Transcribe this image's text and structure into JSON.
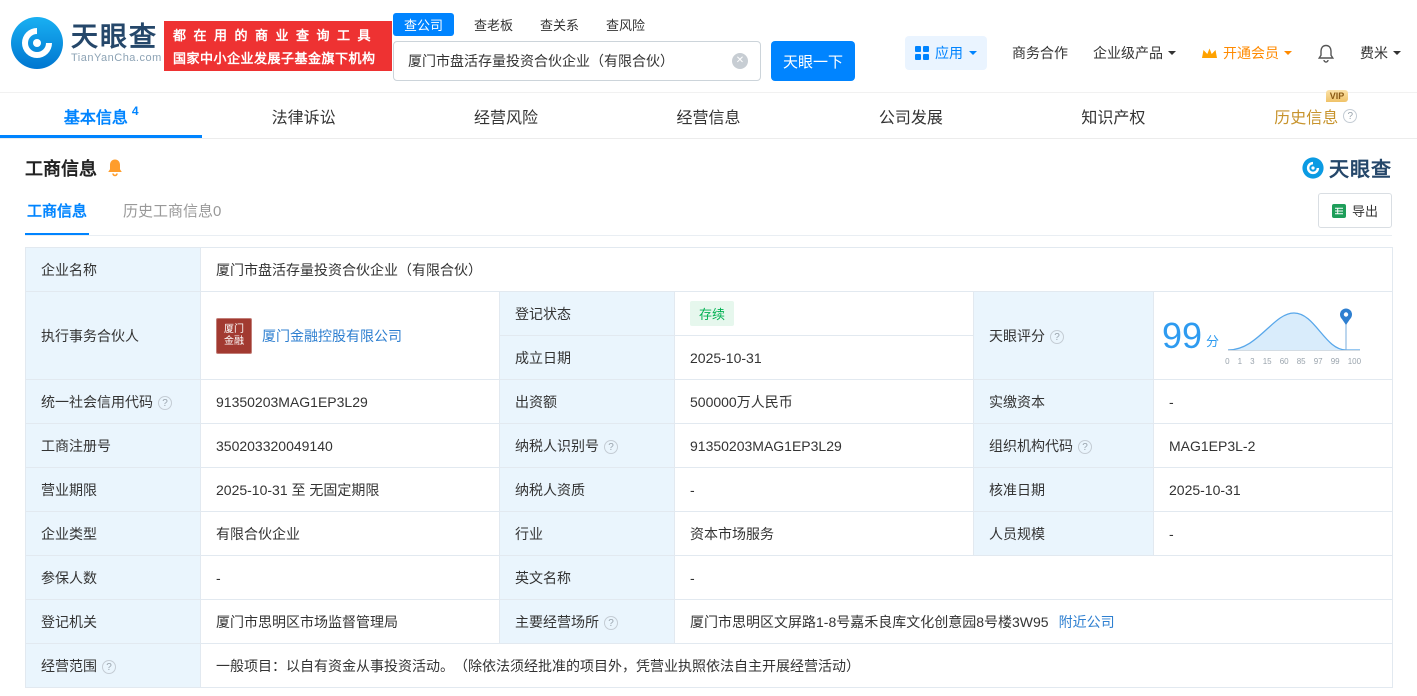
{
  "colors": {
    "brand_blue": "#0084ff",
    "promo_red": "#ee3232",
    "vip_orange": "#ff8a00",
    "status_green": "#00b152",
    "label_cell_bg": "#eaf5fd"
  },
  "header": {
    "logo": {
      "name": "天眼查",
      "domain": "TianYanCha.com"
    },
    "promo": {
      "line1": "都在用的商业查询工具",
      "line2": "国家中小企业发展子基金旗下机构"
    },
    "search": {
      "tabs": [
        {
          "label": "查公司"
        },
        {
          "label": "查老板"
        },
        {
          "label": "查关系"
        },
        {
          "label": "查风险"
        }
      ],
      "value": "厦门市盘活存量投资合伙企业（有限合伙）",
      "submit": "天眼一下"
    },
    "nav": {
      "apps": "应用",
      "cooperation": "商务合作",
      "enterprise": "企业级产品",
      "vip": "开通会员",
      "user": "费米"
    }
  },
  "tabs": {
    "items": [
      {
        "label": "基本信息",
        "count": "4"
      },
      {
        "label": "法律诉讼"
      },
      {
        "label": "经营风险"
      },
      {
        "label": "经营信息"
      },
      {
        "label": "公司发展"
      },
      {
        "label": "知识产权"
      },
      {
        "label": "历史信息",
        "badge": "VIP"
      }
    ]
  },
  "section": {
    "title": "工商信息",
    "logo_text": "天眼查"
  },
  "subtabs": {
    "current": "工商信息",
    "history": "历史工商信息0",
    "export": "导出"
  },
  "info": {
    "company_name_label": "企业名称",
    "company_name": "厦门市盘活存量投资合伙企业（有限合伙）",
    "partner_label": "执行事务合伙人",
    "partner_logo_line1": "厦门",
    "partner_logo_line2": "金融",
    "partner_name": "厦门金融控股有限公司",
    "status_label": "登记状态",
    "status": "存续",
    "established_label": "成立日期",
    "established": "2025-10-31",
    "score_label": "天眼评分",
    "score": "99",
    "score_unit": "分",
    "score_axis": [
      "0",
      "1",
      "3",
      "15",
      "60",
      "85",
      "97",
      "99",
      "100"
    ],
    "credit_code_label": "统一社会信用代码",
    "credit_code": "91350203MAG1EP3L29",
    "capital_label": "出资额",
    "capital": "500000万人民币",
    "paid_capital_label": "实缴资本",
    "paid_capital": "-",
    "reg_number_label": "工商注册号",
    "reg_number": "350203320049140",
    "taxpayer_id_label": "纳税人识别号",
    "taxpayer_id": "91350203MAG1EP3L29",
    "org_code_label": "组织机构代码",
    "org_code": "MAG1EP3L-2",
    "term_label": "营业期限",
    "term": "2025-10-31 至 无固定期限",
    "taxpayer_quality_label": "纳税人资质",
    "taxpayer_quality": "-",
    "approval_date_label": "核准日期",
    "approval_date": "2025-10-31",
    "company_type_label": "企业类型",
    "company_type": "有限合伙企业",
    "industry_label": "行业",
    "industry": "资本市场服务",
    "staff_size_label": "人员规模",
    "staff_size": "-",
    "insured_label": "参保人数",
    "insured": "-",
    "english_name_label": "英文名称",
    "english_name": "-",
    "authority_label": "登记机关",
    "authority": "厦门市思明区市场监督管理局",
    "address_label": "主要经营场所",
    "address": "厦门市思明区文屏路1-8号嘉禾良库文化创意园8号楼3W95",
    "nearby": "附近公司",
    "scope_label": "经营范围",
    "scope": "一般项目：以自有资金从事投资活动。　（除依法须经批准的项目外，凭营业执照依法自主开展经营活动）"
  }
}
